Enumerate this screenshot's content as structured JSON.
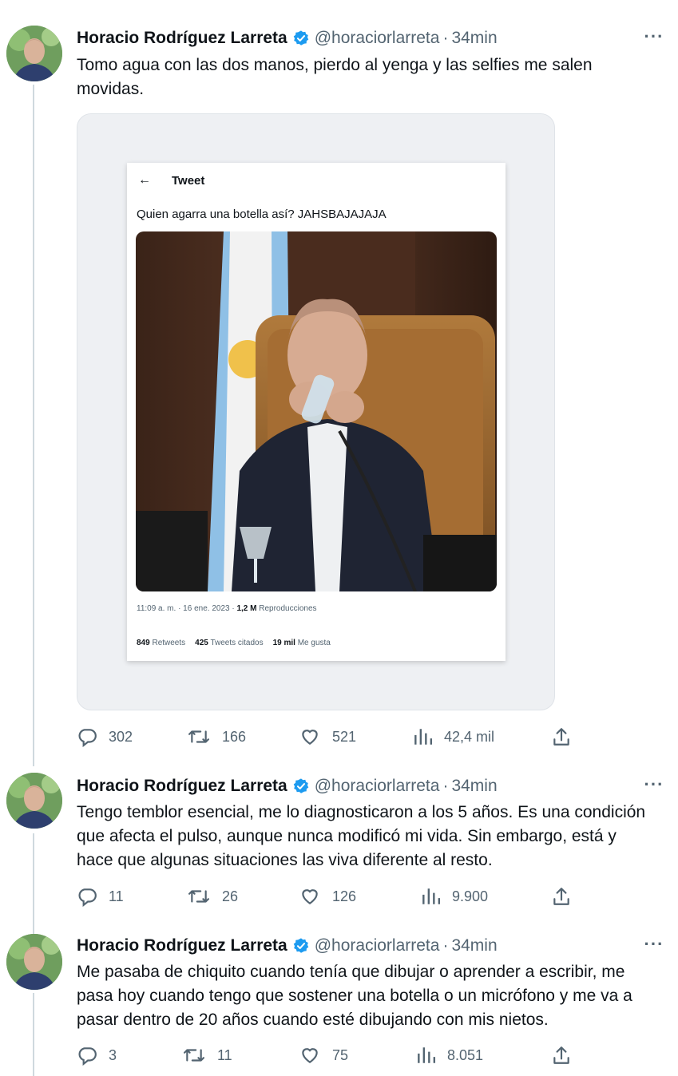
{
  "author": {
    "name": "Horacio Rodríguez Larreta",
    "handle": "@horaciorlarreta",
    "time": "34min"
  },
  "separator": "·",
  "more_label": "···",
  "colors": {
    "verified": "#1d9bf0",
    "muted": "#536471",
    "thread_line": "#cfd9de"
  },
  "icons": [
    "reply-icon",
    "retweet-icon",
    "like-icon",
    "views-icon",
    "share-icon",
    "verified-badge-icon",
    "more-icon"
  ],
  "tweets": [
    {
      "text": "Tomo agua con las dos manos, pierdo al yenga y las selfies me salen movidas.",
      "replies": "302",
      "retweets": "166",
      "likes": "521",
      "views": "42,4 mil",
      "quoted_screenshot": {
        "header": "Tweet",
        "back": "←",
        "text": "Quien agarra una botella así? JAHSBAJAJAJA",
        "meta_time": "11:09 a. m. · 16 ene. 2023 · ",
        "meta_views": "1,2 M",
        "meta_views_label": " Reproducciones",
        "stats": [
          {
            "count": "849",
            "label": " Retweets"
          },
          {
            "count": "425",
            "label": " Tweets citados"
          },
          {
            "count": "19 mil",
            "label": " Me gusta"
          }
        ]
      }
    },
    {
      "text": "Tengo temblor esencial, me lo diagnosticaron a los 5 años. Es una condición que afecta el pulso, aunque nunca modificó mi vida. Sin embargo, está y hace que algunas situaciones las viva diferente al resto.",
      "replies": "11",
      "retweets": "26",
      "likes": "126",
      "views": "9.900"
    },
    {
      "text": "Me pasaba de chiquito cuando tenía que dibujar o aprender a escribir, me pasa hoy cuando tengo que sostener una botella o un micrófono y me va a pasar dentro de 20 años cuando esté dibujando con mis nietos.",
      "replies": "3",
      "retweets": "11",
      "likes": "75",
      "views": "8.051"
    }
  ]
}
